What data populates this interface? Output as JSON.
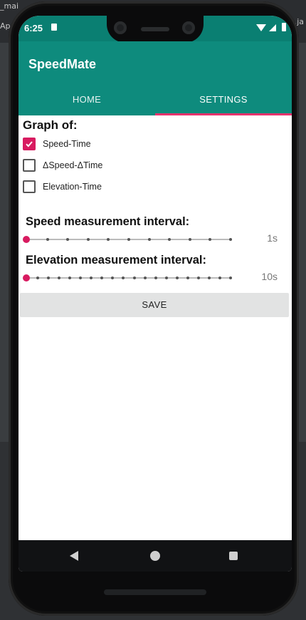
{
  "background": {
    "ide_fragments": [
      "_mai",
      "Ap",
      "s.ja"
    ]
  },
  "status_bar": {
    "time": "6:25"
  },
  "app": {
    "title": "SpeedMate",
    "tabs": [
      {
        "label": "HOME",
        "active": false
      },
      {
        "label": "SETTINGS",
        "active": true
      }
    ]
  },
  "settings": {
    "graph_label": "Graph of:",
    "options": [
      {
        "label": "Speed-Time",
        "checked": true
      },
      {
        "label": "ΔSpeed-ΔTime",
        "checked": false
      },
      {
        "label": "Elevation-Time",
        "checked": false
      }
    ],
    "speed_interval": {
      "label": "Speed measurement interval:",
      "value": "1s",
      "level": 0
    },
    "elevation_interval": {
      "label": "Elevation measurement interval:",
      "value": "10s",
      "level": 0
    },
    "save_label": "SAVE"
  },
  "colors": {
    "primary": "#0e8b7d",
    "accent": "#d81b60"
  },
  "icons": {
    "status_sim": "sim-card-icon",
    "status_wifi": "wifi-icon",
    "status_signal": "cell-signal-icon",
    "status_battery": "battery-icon",
    "nav_back": "back-triangle-icon",
    "nav_home": "home-circle-icon",
    "nav_recents": "recents-square-icon"
  }
}
